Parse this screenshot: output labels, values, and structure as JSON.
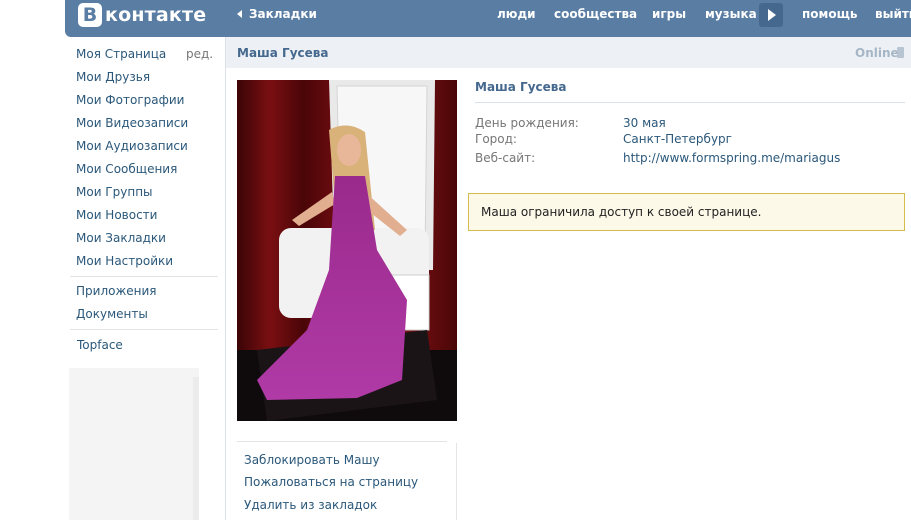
{
  "header": {
    "logo_letter": "В",
    "logo_text": "контакте",
    "bookmarks": "Закладки",
    "nav": [
      "люди",
      "сообщества",
      "игры",
      "музыка",
      "помощь",
      "выйти"
    ]
  },
  "sidebar": {
    "edit": "ред.",
    "items": [
      "Моя Страница",
      "Мои Друзья",
      "Мои Фотографии",
      "Мои Видеозаписи",
      "Мои Аудиозаписи",
      "Мои Сообщения",
      "Мои Группы",
      "Мои Новости",
      "Мои Закладки",
      "Мои Настройки"
    ],
    "apps": [
      "Приложения",
      "Документы"
    ],
    "extra": "Topface"
  },
  "profile": {
    "header_name": "Маша Гусева",
    "status": "Online",
    "name": "Маша Гусева",
    "fields": [
      {
        "label": "День рождения:",
        "value": "30 мая"
      },
      {
        "label": "Город:",
        "value": "Санкт-Петербург"
      },
      {
        "label": "Веб-сайт:",
        "value": "http://www.formspring.me/mariagus"
      }
    ],
    "notice": "Маша ограничила доступ к своей странице.",
    "actions": [
      "Заблокировать Машу",
      "Пожаловаться на страницу",
      "Удалить из закладок"
    ]
  },
  "colors": {
    "header_bg": "#597da3",
    "link": "#2b587a",
    "notice_bg": "#fcf9e8",
    "notice_border": "#d4bc4c"
  }
}
